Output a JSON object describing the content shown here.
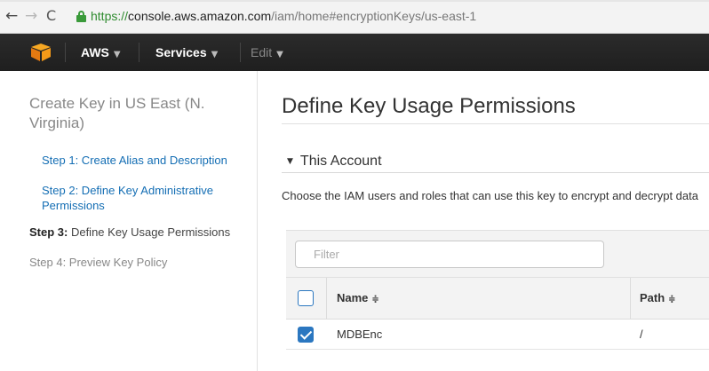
{
  "browser": {
    "url_scheme": "https://",
    "url_host": "console.aws.amazon.com",
    "url_path": "/iam/home#encryptionKeys/us-east-1"
  },
  "topnav": {
    "aws_label": "AWS",
    "services_label": "Services",
    "edit_label": "Edit"
  },
  "sidebar": {
    "title": "Create Key in US East (N. Virginia)",
    "step1": "Step 1: Create Alias and Description",
    "step2": "Step 2: Define Key Administrative Permissions",
    "step3_prefix": "Step 3:",
    "step3_text": " Define Key Usage Permissions",
    "step4": "Step 4: Preview Key Policy"
  },
  "main": {
    "title": "Define Key Usage Permissions",
    "section_title": "This Account",
    "description": "Choose the IAM users and roles that can use this key to encrypt and decrypt data"
  },
  "table": {
    "filter_placeholder": "Filter",
    "columns": [
      "Name",
      "Path"
    ],
    "sort_glyph": "≑",
    "rows": [
      {
        "checked": true,
        "name": "MDBEnc",
        "path": "/"
      }
    ]
  },
  "colors": {
    "link": "#146eb4",
    "checkbox": "#2b77c0",
    "nav_bg": "#232f3e"
  }
}
